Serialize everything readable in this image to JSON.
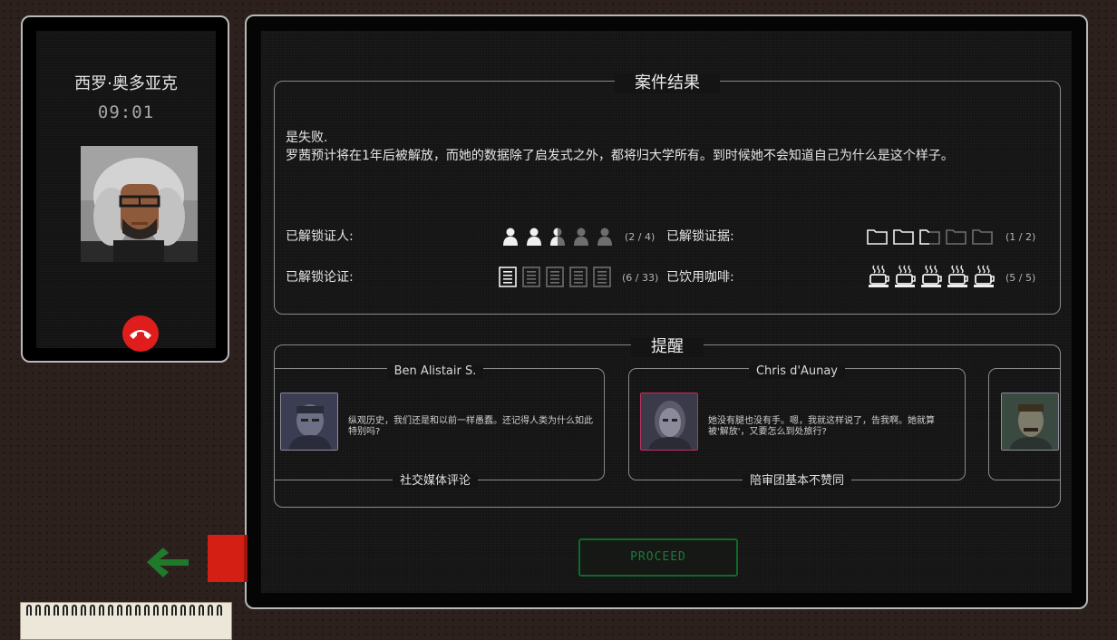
{
  "phone": {
    "caller_name": "西罗·奥多亚克",
    "call_time": "09:01",
    "hangup_color": "#e01d1d"
  },
  "case_result": {
    "title": "案件结果",
    "verdict_line1": "是失败.",
    "verdict_line2": "罗茜预计将在1年后被解放，而她的数据除了启发式之外，都将归大学所有。到时候她不会知道自己为什么是这个样子。",
    "stats": {
      "witnesses": {
        "label": "已解锁证人:",
        "count": "(2 / 4)",
        "icon": "person-icon",
        "total_icons": 5,
        "filled": 2,
        "partial": 1
      },
      "evidence": {
        "label": "已解锁证据:",
        "count": "(1 / 2)",
        "icon": "folder-icon",
        "total_icons": 5,
        "filled": 2,
        "partial": 1
      },
      "arguments": {
        "label": "已解锁论证:",
        "count": "(6 / 33)",
        "icon": "document-icon",
        "total_icons": 5,
        "filled": 1,
        "partial": 0
      },
      "coffee": {
        "label": "已饮用咖啡:",
        "count": "(5 / 5)",
        "icon": "coffee-cup-icon",
        "total_icons": 5,
        "filled": 5,
        "partial": 0
      }
    }
  },
  "reminders": {
    "title": "提醒",
    "cards": [
      {
        "name": "Ben Alistair S.",
        "text": "纵观历史，我们还是和以前一样愚蠢。还记得人类为什么如此特别吗?",
        "tag": "社交媒体评论",
        "portrait_border": "#8c8c9a"
      },
      {
        "name": "Chris d'Aunay",
        "text": "她没有腿也没有手。嗯，我就这样说了，告我啊。她就算被'解放'，又要怎么到处旅行?",
        "tag": "陪审团基本不赞同",
        "portrait_border": "#c2305e"
      }
    ]
  },
  "proceed_label": "PROCEED",
  "accent_green": "#1d7a3a"
}
